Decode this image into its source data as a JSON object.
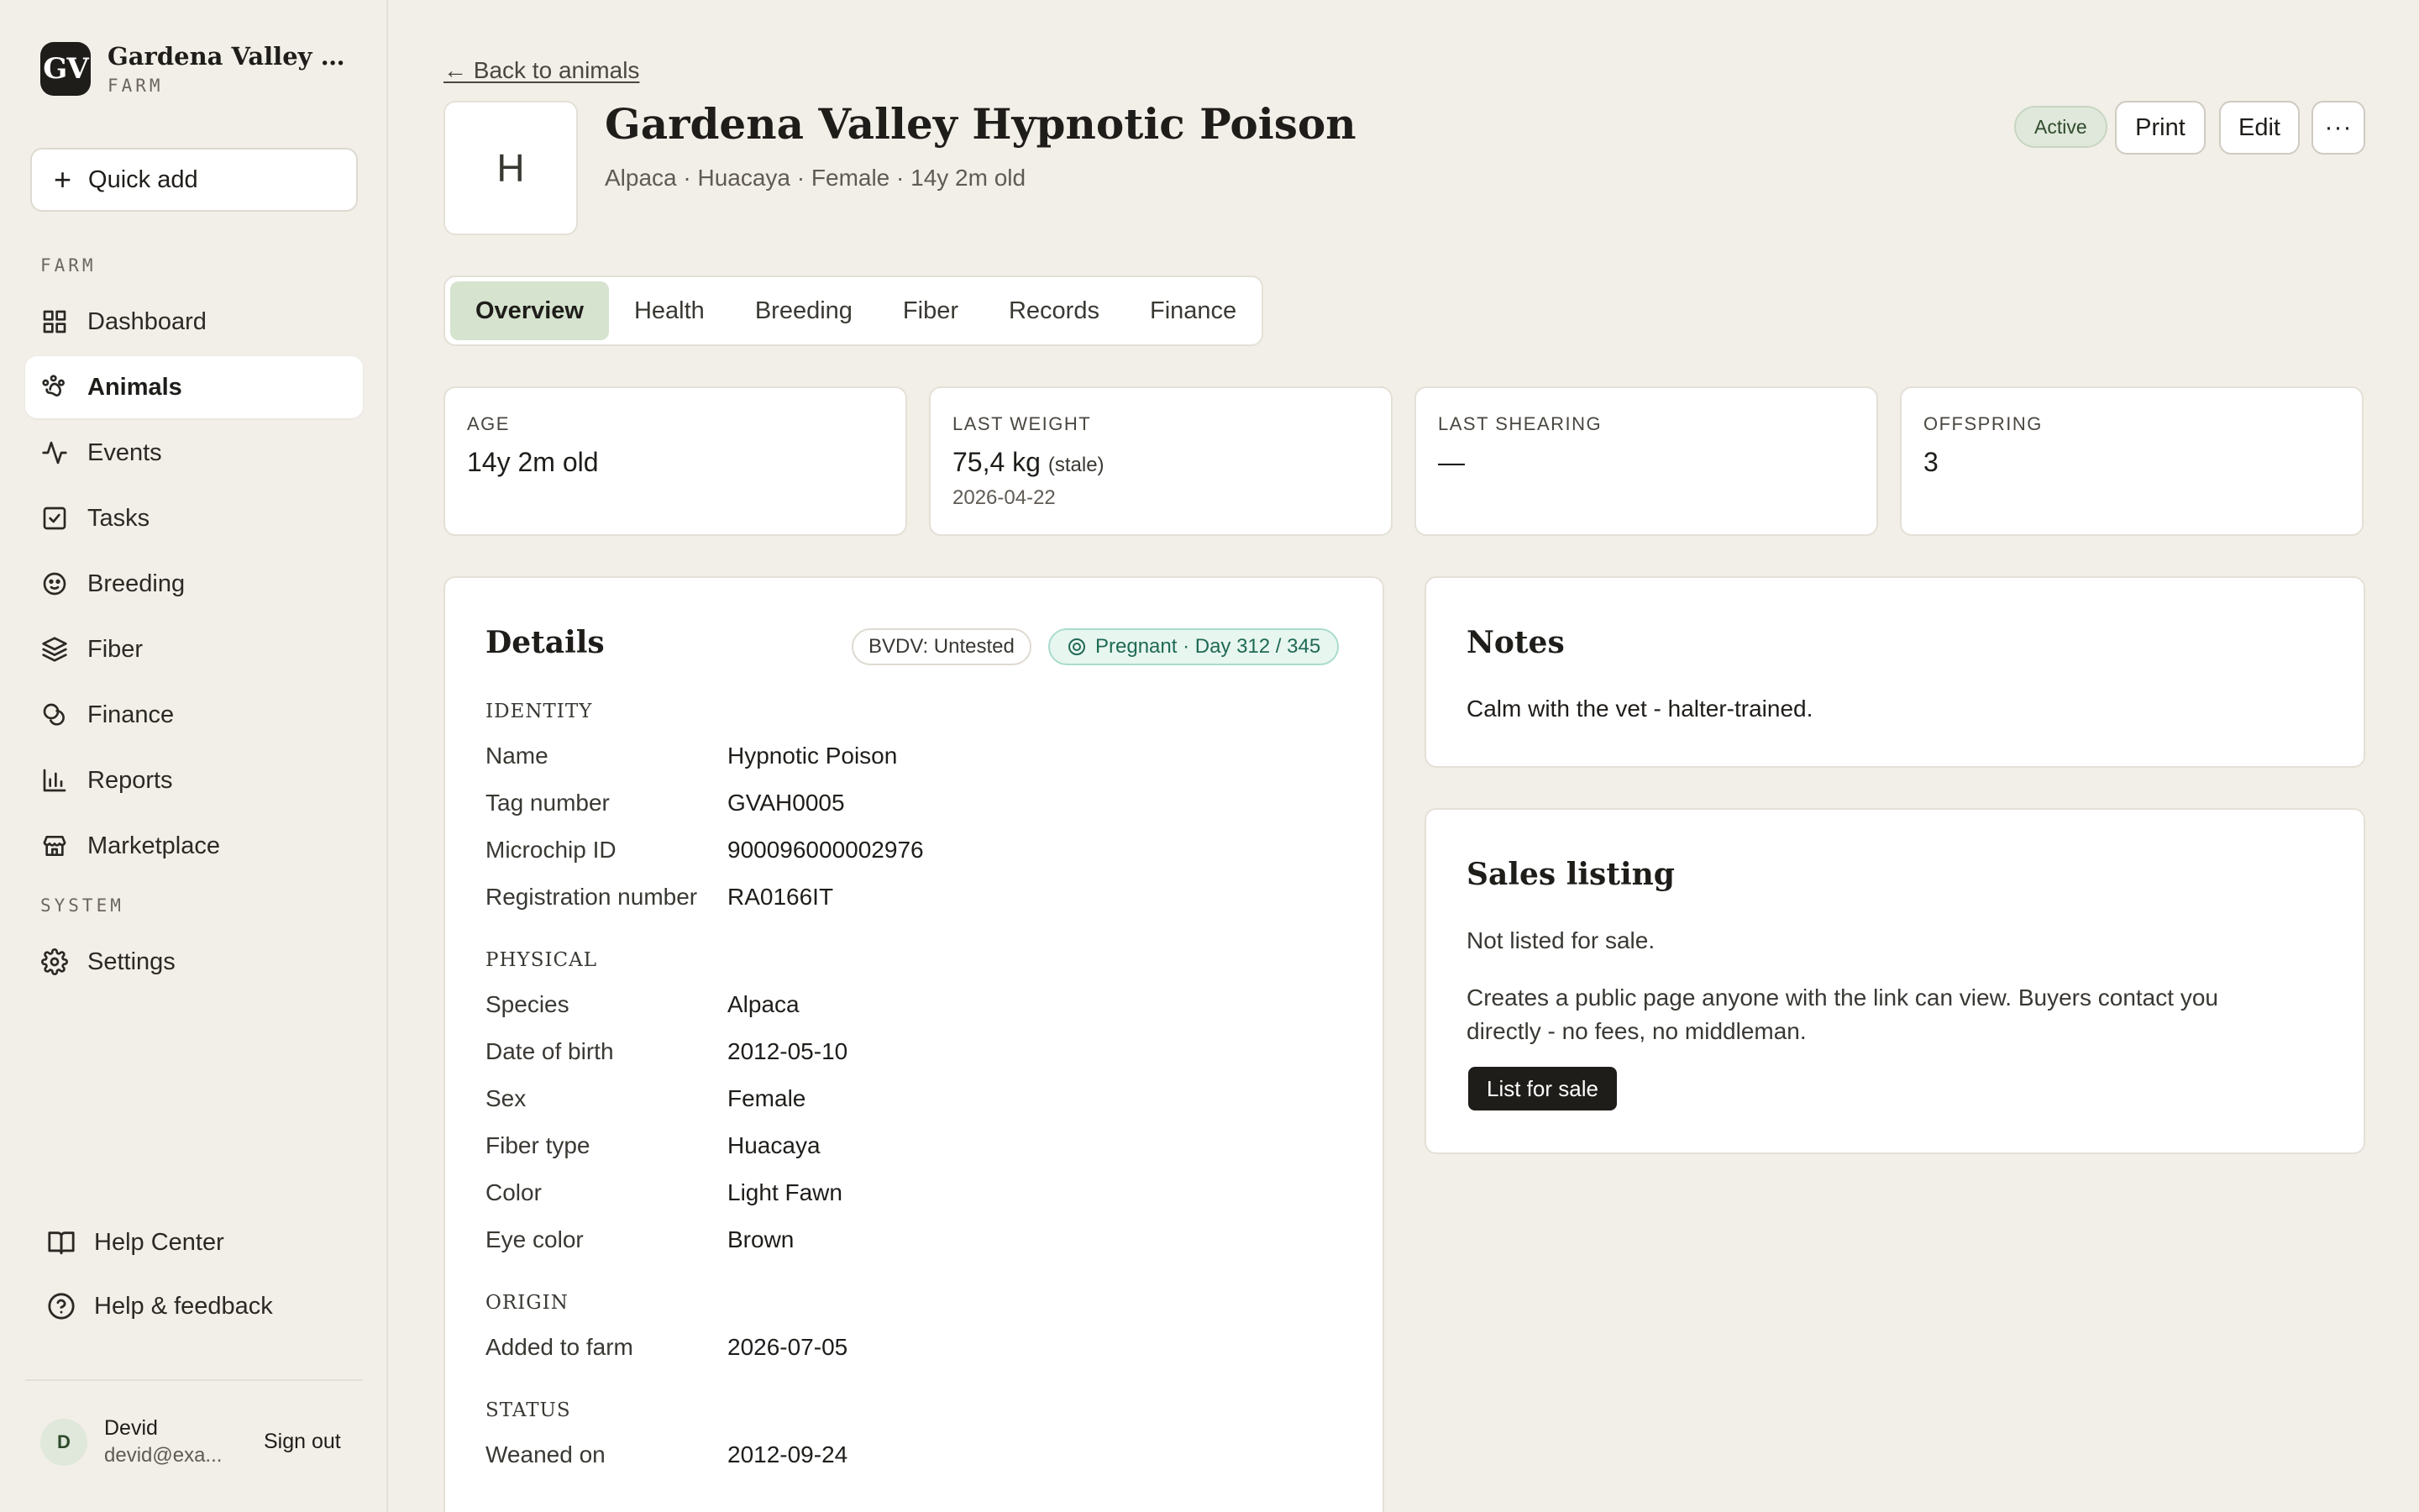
{
  "brand": {
    "logo": "GV",
    "name": "Gardena Valley Alp...",
    "sub": "FARM"
  },
  "sidebar": {
    "quick_add": "Quick add",
    "farm_label": "FARM",
    "system_label": "SYSTEM",
    "items": [
      {
        "label": "Dashboard",
        "icon": "grid-icon"
      },
      {
        "label": "Animals",
        "icon": "paw-icon",
        "active": true
      },
      {
        "label": "Events",
        "icon": "activity-icon"
      },
      {
        "label": "Tasks",
        "icon": "checkbox-icon"
      },
      {
        "label": "Breeding",
        "icon": "breeding-icon"
      },
      {
        "label": "Fiber",
        "icon": "layers-icon"
      },
      {
        "label": "Finance",
        "icon": "coins-icon"
      },
      {
        "label": "Reports",
        "icon": "bar-chart-icon"
      },
      {
        "label": "Marketplace",
        "icon": "store-icon"
      }
    ],
    "settings": "Settings",
    "help_center": "Help Center",
    "help_feedback": "Help & feedback",
    "user": {
      "initial": "D",
      "name": "Devid",
      "email": "devid@exa...",
      "sign_out": "Sign out"
    }
  },
  "header": {
    "back": "← Back to animals",
    "avatar_letter": "H",
    "title": "Gardena Valley Hypnotic Poison",
    "subtitle": "Alpaca · Huacaya · Female · 14y 2m old",
    "status": "Active",
    "print": "Print",
    "edit": "Edit",
    "more": "···"
  },
  "tabs": [
    "Overview",
    "Health",
    "Breeding",
    "Fiber",
    "Records",
    "Finance"
  ],
  "stats": {
    "age": {
      "label": "AGE",
      "value": "14y 2m old"
    },
    "weight": {
      "label": "LAST WEIGHT",
      "value": "75,4 kg",
      "note": "(stale)",
      "date": "2026-04-22"
    },
    "shearing": {
      "label": "LAST SHEARING",
      "value": "—"
    },
    "offspring": {
      "label": "OFFSPRING",
      "value": "3"
    }
  },
  "details": {
    "title": "Details",
    "bvdv": "BVDV: Untested",
    "pregnant": "Pregnant · Day 312 / 345",
    "identity": {
      "heading": "IDENTITY",
      "name_label": "Name",
      "name": "Hypnotic Poison",
      "tag_label": "Tag number",
      "tag": "GVAH0005",
      "chip_label": "Microchip ID",
      "chip": "900096000002976",
      "reg_label": "Registration number",
      "reg": "RA0166IT"
    },
    "physical": {
      "heading": "PHYSICAL",
      "species_label": "Species",
      "species": "Alpaca",
      "dob_label": "Date of birth",
      "dob": "2012-05-10",
      "sex_label": "Sex",
      "sex": "Female",
      "fiber_label": "Fiber type",
      "fiber": "Huacaya",
      "color_label": "Color",
      "color": "Light Fawn",
      "eye_label": "Eye color",
      "eye": "Brown"
    },
    "origin": {
      "heading": "ORIGIN",
      "added_label": "Added to farm",
      "added": "2026-07-05"
    },
    "status": {
      "heading": "STATUS",
      "weaned_label": "Weaned on",
      "weaned": "2012-09-24"
    }
  },
  "notes": {
    "title": "Notes",
    "text": "Calm with the vet - halter-trained."
  },
  "sales": {
    "title": "Sales listing",
    "status": "Not listed for sale.",
    "desc": "Creates a public page anyone with the link can view. Buyers contact you directly - no fees, no middleman.",
    "button": "List for sale"
  },
  "colors": {
    "background": "#f2efe8",
    "accent_green": "#d5e3cf",
    "dark": "#1f1d1a",
    "pregnant_teal": "#1f6a55"
  }
}
